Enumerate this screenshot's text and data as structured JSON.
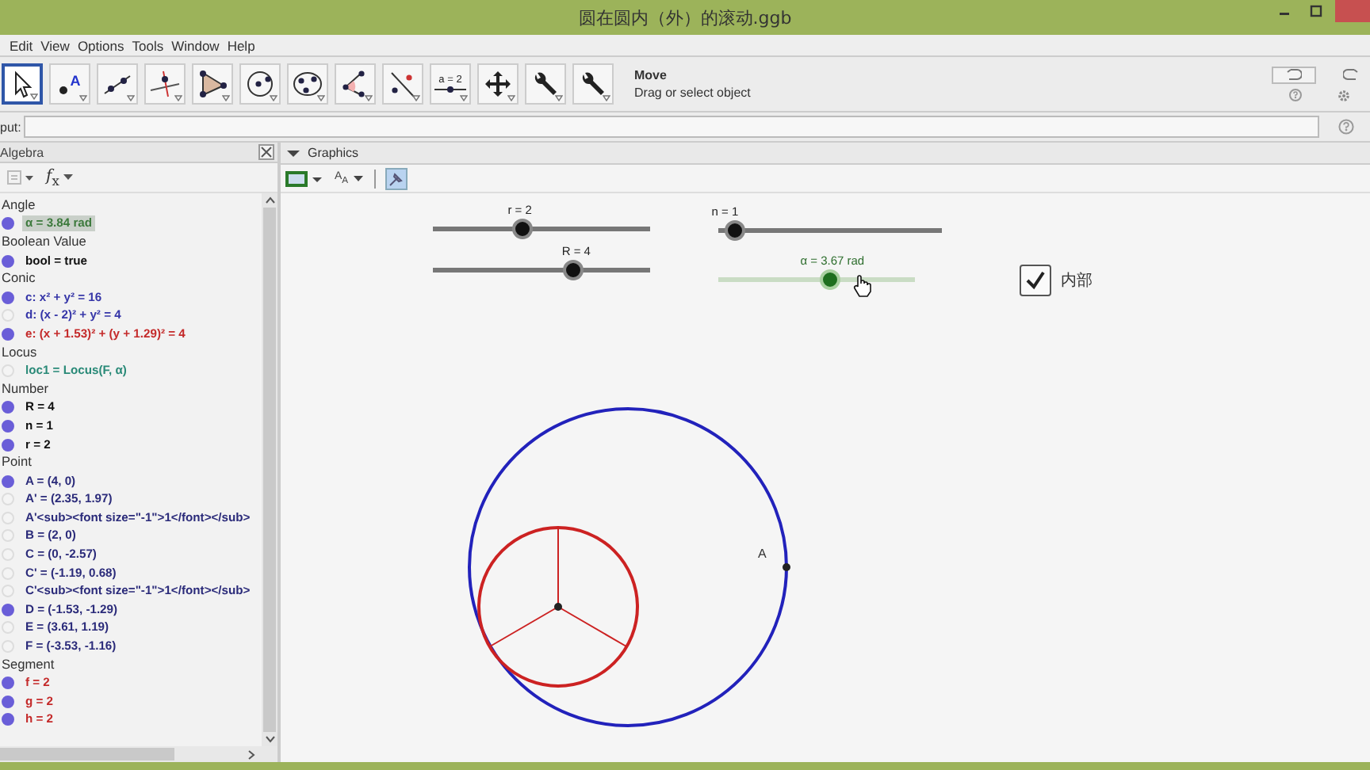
{
  "window": {
    "title": "圆在圆内（外）的滚动.ggb"
  },
  "menu": [
    "Edit",
    "View",
    "Options",
    "Tools",
    "Window",
    "Help"
  ],
  "toolbar": {
    "tools": [
      {
        "kind": "move",
        "selected": true
      },
      {
        "kind": "point",
        "label": "A",
        "selected": false
      },
      {
        "kind": "line",
        "selected": false
      },
      {
        "kind": "perpendicular",
        "selected": false
      },
      {
        "kind": "polygon",
        "selected": false
      },
      {
        "kind": "circle",
        "selected": false
      },
      {
        "kind": "ellipse",
        "selected": false
      },
      {
        "kind": "angle",
        "selected": false
      },
      {
        "kind": "reflect",
        "selected": false
      },
      {
        "kind": "slider",
        "label": "a = 2",
        "selected": false
      },
      {
        "kind": "move-view",
        "selected": false
      },
      {
        "kind": "wrench",
        "selected": false
      },
      {
        "kind": "wrench",
        "selected": false
      }
    ],
    "hint_title": "Move",
    "hint_text": "Drag or select object"
  },
  "input_bar": {
    "label": "put:"
  },
  "algebra": {
    "title": "Algebra",
    "function_label": "*f*$_{x}$",
    "groups": [
      {
        "name": "Angle",
        "items": [
          {
            "text": "α = 3.84 rad",
            "visible": true,
            "selected": true,
            "color": "#3d7a3d"
          }
        ]
      },
      {
        "name": "Boolean Value",
        "items": [
          {
            "text": "bool = true",
            "visible": true,
            "selected": false,
            "color": "#111111"
          }
        ]
      },
      {
        "name": "Conic",
        "items": [
          {
            "text": "c: x² + y² = 16",
            "visible": true,
            "selected": false,
            "color": "#3636a8"
          },
          {
            "text": "d: (x - 2)² + y² = 4",
            "visible": false,
            "selected": false,
            "color": "#3636a8"
          },
          {
            "text": "e: (x + 1.53)² + (y + 1.29)² = 4",
            "visible": true,
            "selected": false,
            "color": "#c42a2a"
          }
        ]
      },
      {
        "name": "Locus",
        "items": [
          {
            "text": "loc1 = Locus(F, α)",
            "visible": false,
            "selected": false,
            "color": "#2a8a78"
          }
        ]
      },
      {
        "name": "Number",
        "items": [
          {
            "text": "R = 4",
            "visible": true,
            "selected": false,
            "color": "#111111"
          },
          {
            "text": "n = 1",
            "visible": true,
            "selected": false,
            "color": "#111111"
          },
          {
            "text": "r = 2",
            "visible": true,
            "selected": false,
            "color": "#111111"
          }
        ]
      },
      {
        "name": "Point",
        "items": [
          {
            "text": "A = (4, 0)",
            "visible": true,
            "selected": false,
            "color": "#2b2b7a"
          },
          {
            "text": "A' = (2.35, 1.97)",
            "visible": false,
            "selected": false,
            "color": "#2b2b7a"
          },
          {
            "text": "A'<sub><font size=\"-1\">1</font></sub>",
            "visible": false,
            "selected": false,
            "color": "#2b2b7a"
          },
          {
            "text": "B = (2, 0)",
            "visible": false,
            "selected": false,
            "color": "#2b2b7a"
          },
          {
            "text": "C = (0, -2.57)",
            "visible": false,
            "selected": false,
            "color": "#2b2b7a"
          },
          {
            "text": "C' = (-1.19, 0.68)",
            "visible": false,
            "selected": false,
            "color": "#2b2b7a"
          },
          {
            "text": "C'<sub><font size=\"-1\">1</font></sub>",
            "visible": false,
            "selected": false,
            "color": "#2b2b7a"
          },
          {
            "text": "D = (-1.53, -1.29)",
            "visible": true,
            "selected": false,
            "color": "#2b2b7a"
          },
          {
            "text": "E = (3.61, 1.19)",
            "visible": false,
            "selected": false,
            "color": "#2b2b7a"
          },
          {
            "text": "F = (-3.53, -1.16)",
            "visible": false,
            "selected": false,
            "color": "#2b2b7a"
          }
        ]
      },
      {
        "name": "Segment",
        "items": [
          {
            "text": "f = 2",
            "visible": true,
            "selected": false,
            "color": "#c42a2a"
          },
          {
            "text": "g = 2",
            "visible": true,
            "selected": false,
            "color": "#c42a2a"
          },
          {
            "text": "h = 2",
            "visible": true,
            "selected": false,
            "color": "#c42a2a"
          }
        ]
      }
    ]
  },
  "graphics": {
    "title": "Graphics",
    "font_label": "A$_{A}$",
    "sliders": [
      {
        "label": "r = 2",
        "level": 0.4,
        "selected": false
      },
      {
        "label": "R = 4",
        "level": 0.66,
        "selected": false
      },
      {
        "label": "n = 1",
        "level": 0.03,
        "selected": false
      },
      {
        "label": "α = 3.67 rad",
        "level": 0.58,
        "selected": true
      }
    ],
    "checkbox": {
      "label": "内部",
      "checked": true
    },
    "point_label": "A"
  }
}
